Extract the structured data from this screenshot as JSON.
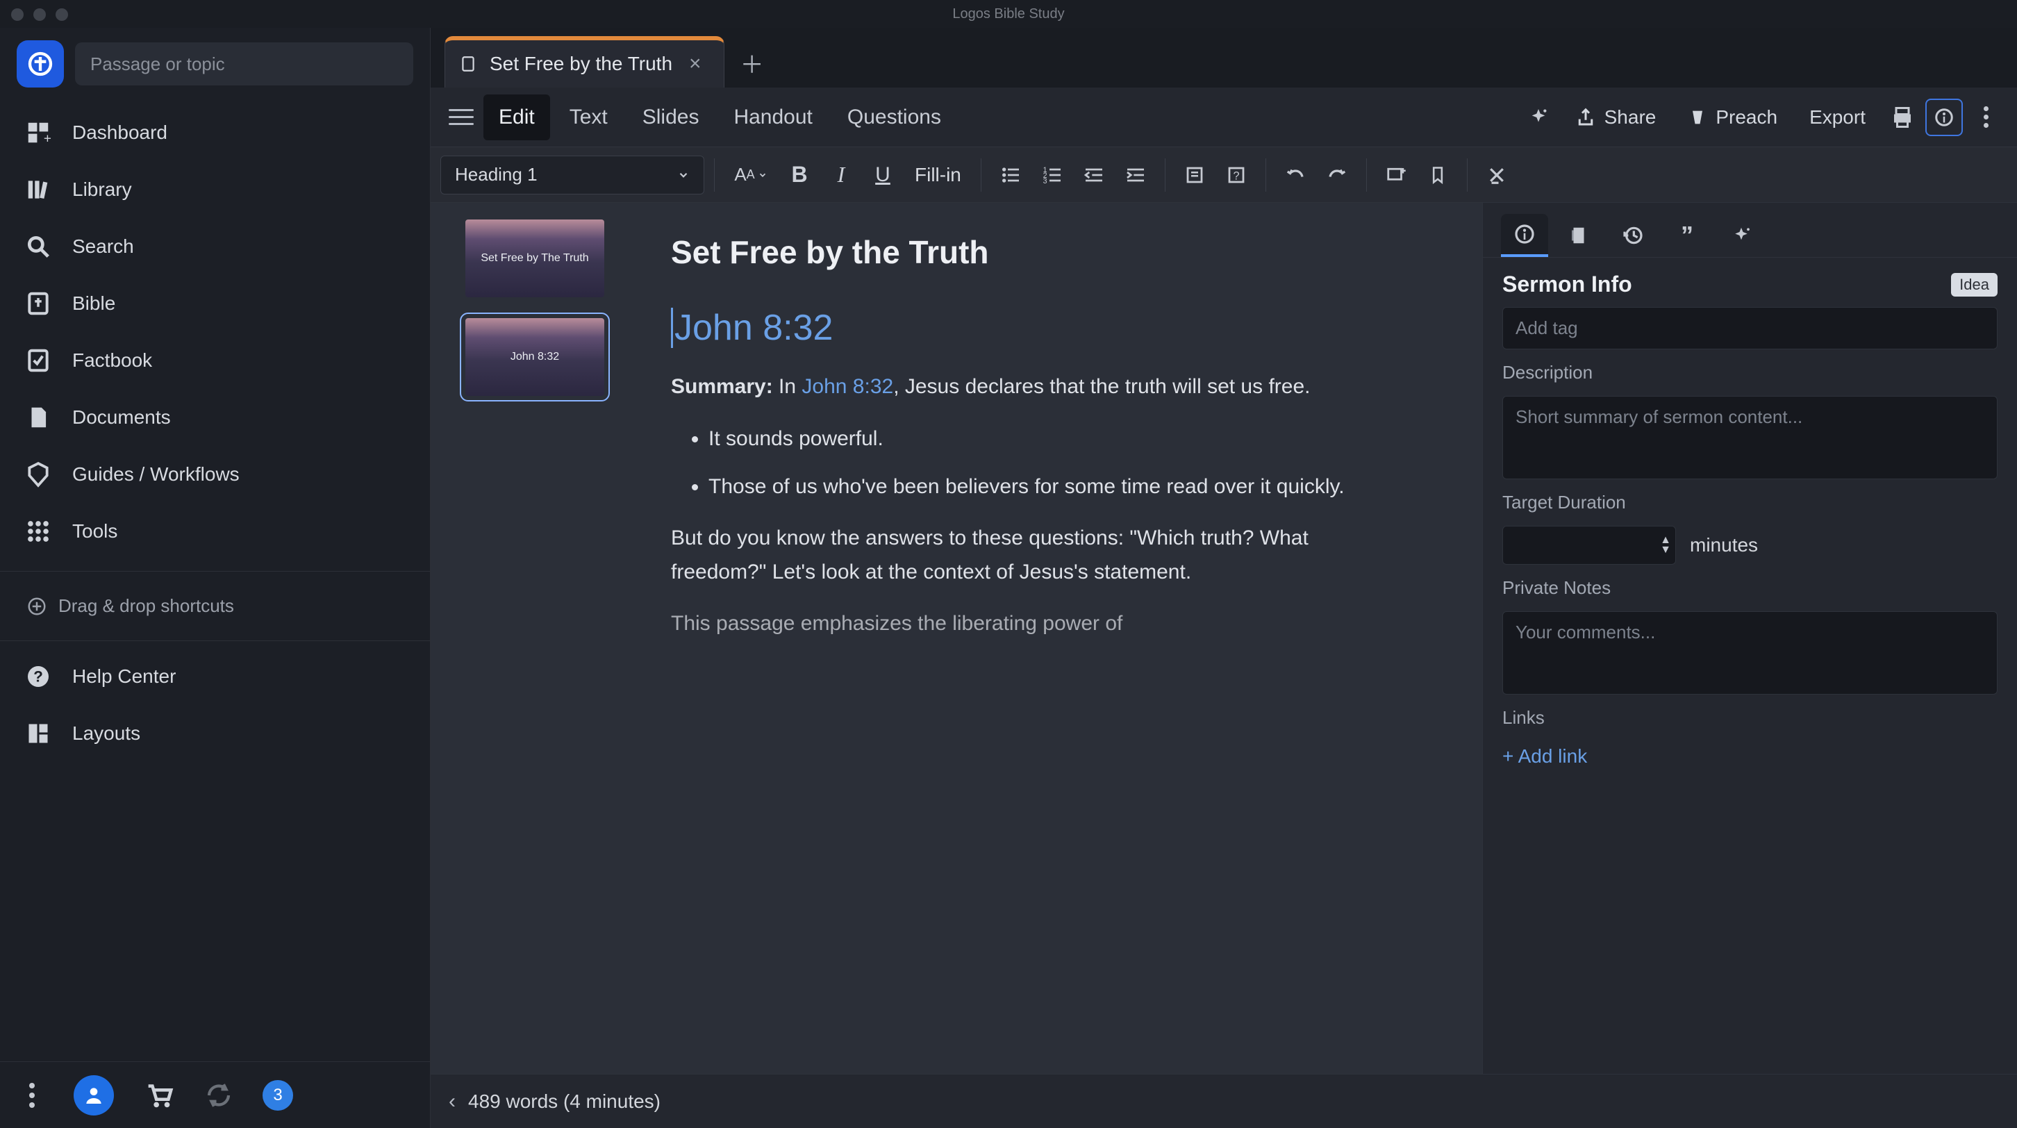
{
  "app_title": "Logos Bible Study",
  "search_placeholder": "Passage or topic",
  "nav": {
    "dashboard": "Dashboard",
    "library": "Library",
    "search": "Search",
    "bible": "Bible",
    "factbook": "Factbook",
    "documents": "Documents",
    "guides": "Guides / Workflows",
    "tools": "Tools"
  },
  "drag_hint": "Drag & drop shortcuts",
  "help_center": "Help Center",
  "layouts": "Layouts",
  "notification_count": "3",
  "tab": {
    "title": "Set Free by the Truth"
  },
  "modes": {
    "edit": "Edit",
    "text": "Text",
    "slides": "Slides",
    "handout": "Handout",
    "questions": "Questions"
  },
  "actions": {
    "share": "Share",
    "preach": "Preach",
    "export": "Export"
  },
  "format": {
    "style": "Heading 1",
    "fillin": "Fill-in"
  },
  "slides": {
    "thumb1": "Set Free by The Truth",
    "thumb2": "John 8:32"
  },
  "content": {
    "title": "Set Free by the Truth",
    "passage": "John 8:32",
    "summary_label": "Summary:",
    "summary_lead": " In ",
    "summary_ref": "John 8:32",
    "summary_tail": ", Jesus declares that the truth will set us free.",
    "bullet1": "It sounds powerful.",
    "bullet2": "Those of us who've been believers for some time read over it quickly.",
    "para2": "But do you know the answers to these questions: \"Which truth? What freedom?\" Let's look at the context of Jesus's statement.",
    "para3": "This passage emphasizes the liberating power of"
  },
  "inspector": {
    "title": "Sermon Info",
    "idea": "Idea",
    "tag_placeholder": "Add tag",
    "description_label": "Description",
    "description_placeholder": "Short summary of sermon content...",
    "target_label": "Target Duration",
    "minutes": "minutes",
    "notes_label": "Private Notes",
    "notes_placeholder": "Your comments...",
    "links_label": "Links",
    "add_link": "+ Add link"
  },
  "status": {
    "words": "489 words (4 minutes)"
  }
}
